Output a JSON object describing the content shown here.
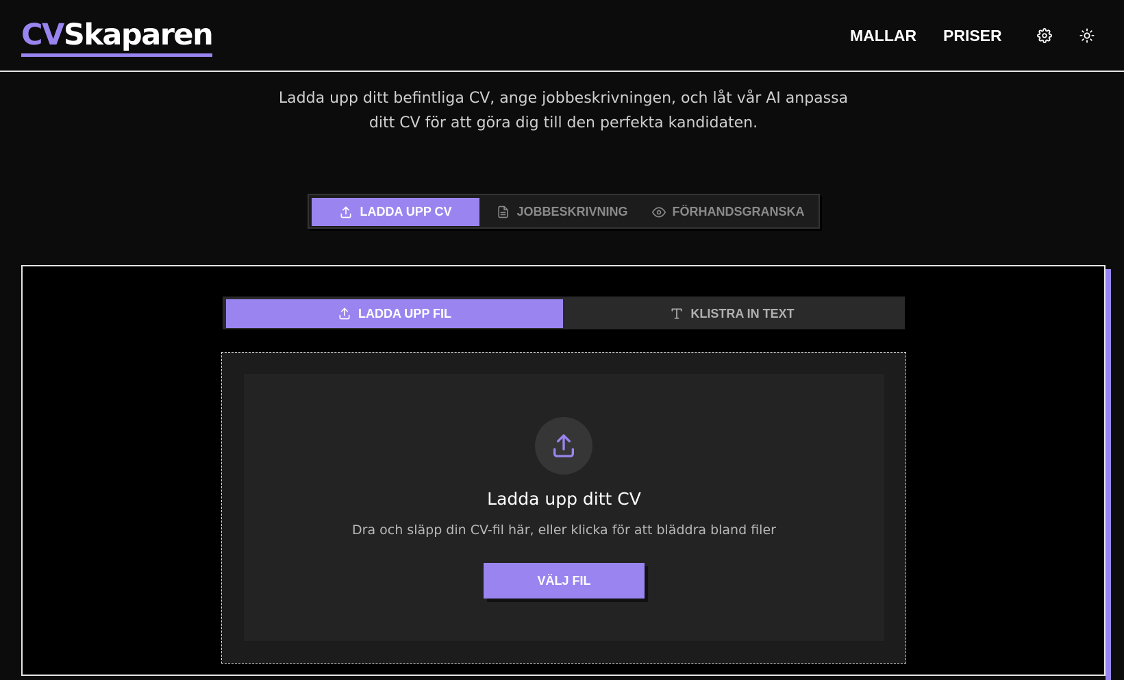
{
  "header": {
    "logo_accent": "CV",
    "logo_rest": "Skaparen",
    "nav": [
      "MALLAR",
      "PRISER"
    ],
    "icons": [
      "settings-icon",
      "sun-icon"
    ]
  },
  "intro": {
    "line1": "Ladda upp ditt befintliga CV, ange jobbeskrivningen, och låt vår AI anpassa",
    "line2": "ditt CV för att göra dig till den perfekta kandidaten."
  },
  "main_tabs": [
    {
      "label": "LADDA UPP CV",
      "icon": "upload-icon",
      "active": true
    },
    {
      "label": "JOBBESKRIVNING",
      "icon": "document-icon",
      "active": false
    },
    {
      "label": "FÖRHANDSGRANSKA",
      "icon": "eye-icon",
      "active": false
    }
  ],
  "sub_tabs": [
    {
      "label": "LADDA UPP FIL",
      "icon": "upload-icon",
      "active": true
    },
    {
      "label": "KLISTRA IN TEXT",
      "icon": "text-icon",
      "active": false
    }
  ],
  "dropzone": {
    "title": "Ladda upp ditt CV",
    "subtitle": "Dra och släpp din CV-fil här, eller klicka för att bläddra bland filer",
    "button_label": "VÄLJ FIL"
  },
  "colors": {
    "accent": "#9a85f0",
    "background": "#0c0c0c",
    "panel": "#000000",
    "dropzone_inner": "#232323"
  }
}
